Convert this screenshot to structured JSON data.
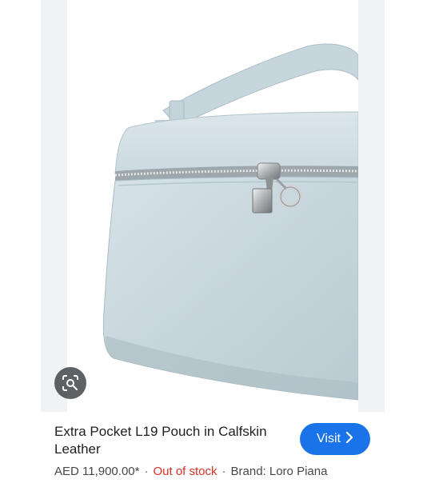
{
  "product": {
    "title": "Extra Pocket L19 Pouch in Calfskin Leather",
    "price": "AED 11,900.00*",
    "stock_status": "Out of stock",
    "brand": "Brand: Loro Piana",
    "separator": "·"
  },
  "actions": {
    "visit_label": "Visit",
    "lens_icon": "lens-search-icon",
    "visit_icon": "chevron-right-icon"
  },
  "colors": {
    "accent": "#1a73e8",
    "out_of_stock": "#d93025",
    "bag": "#cbd9df"
  }
}
